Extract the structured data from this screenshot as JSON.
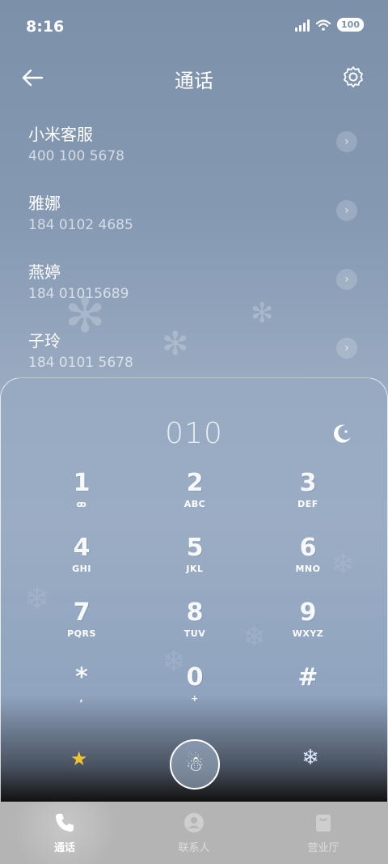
{
  "status_bar": {
    "time": "8:16",
    "battery": "100"
  },
  "header": {
    "title": "通话"
  },
  "recent_calls": [
    {
      "name": "小米客服",
      "number": "400 100 5678"
    },
    {
      "name": "雅娜",
      "number": "184 0102 4685"
    },
    {
      "name": "燕婷",
      "number": "184 01015689"
    },
    {
      "name": "子玲",
      "number": "184 0101 5678"
    }
  ],
  "dialpad": {
    "input": "010",
    "keys": [
      {
        "digit": "1",
        "sub": "ꝏ"
      },
      {
        "digit": "2",
        "sub": "ABC"
      },
      {
        "digit": "3",
        "sub": "DEF"
      },
      {
        "digit": "4",
        "sub": "GHI"
      },
      {
        "digit": "5",
        "sub": "JKL"
      },
      {
        "digit": "6",
        "sub": "MNO"
      },
      {
        "digit": "7",
        "sub": "PQRS"
      },
      {
        "digit": "8",
        "sub": "TUV"
      },
      {
        "digit": "9",
        "sub": "WXYZ"
      },
      {
        "digit": "*",
        "sub": ","
      },
      {
        "digit": "0",
        "sub": "+"
      },
      {
        "digit": "#",
        "sub": ""
      }
    ]
  },
  "tabs": [
    {
      "label": "通话",
      "active": true
    },
    {
      "label": "联系人",
      "active": false
    },
    {
      "label": "营业厅",
      "active": false
    }
  ],
  "icons": {
    "back": "back-arrow-icon",
    "settings": "gear-icon",
    "theme": "moon-icon",
    "star": "star-icon",
    "call": "snowman-icon",
    "snow": "snowflake-icon"
  }
}
